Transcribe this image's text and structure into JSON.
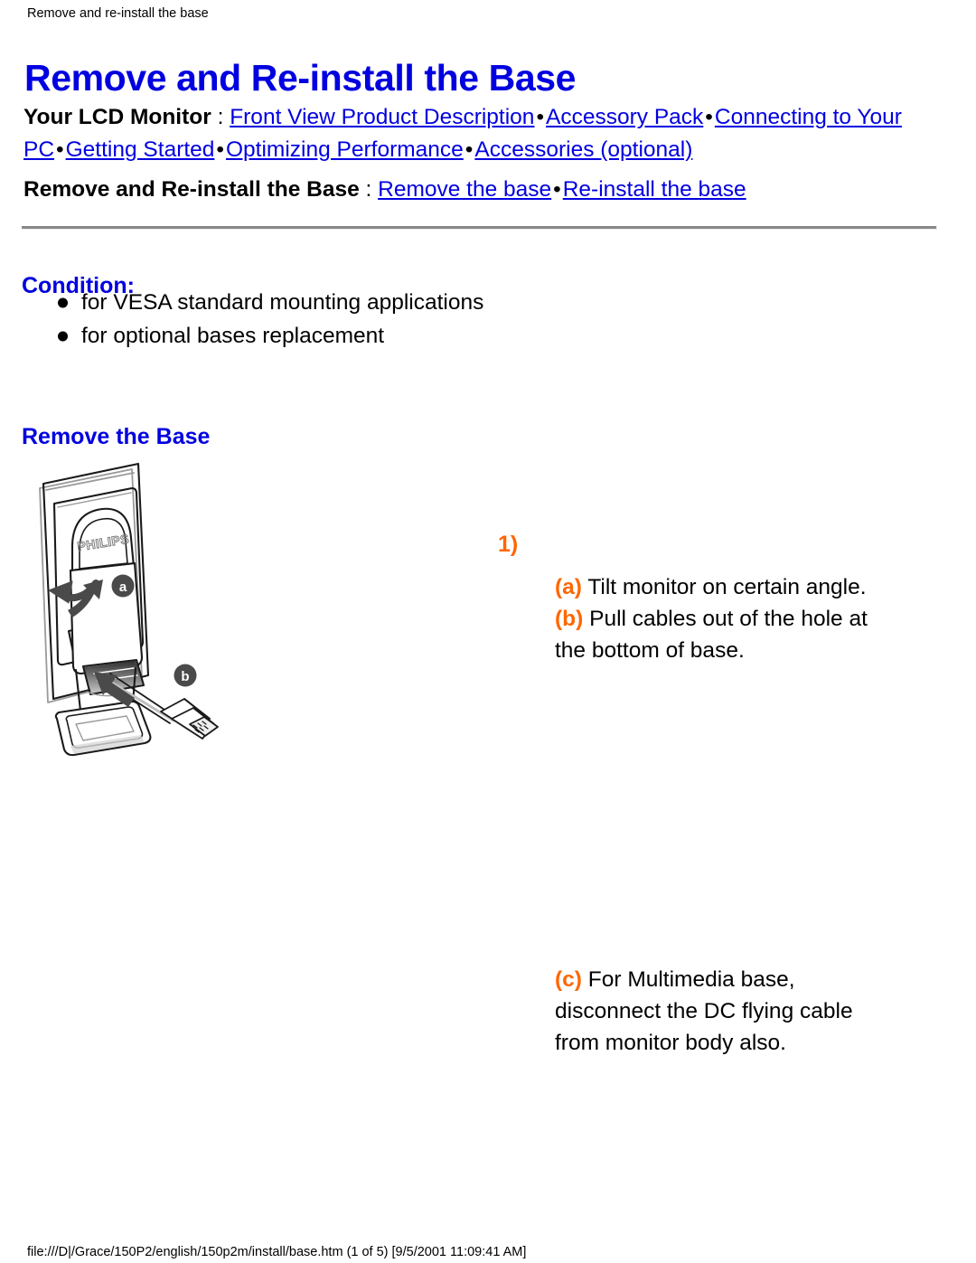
{
  "document": {
    "breadcrumb": "Remove and re-install the base",
    "title": "Remove and Re-install the Base",
    "footer": "file:///D|/Grace/150P2/english/150p2m/install/base.htm (1 of 5) [9/5/2001 11:09:41 AM]"
  },
  "colors": {
    "link": "#0000e0",
    "heading": "#0000e0",
    "accent_orange": "#ff6600",
    "text": "#000000",
    "rule": "#888888",
    "background": "#ffffff"
  },
  "nav_primary": {
    "lead": "Your LCD Monitor",
    "colon": " : ",
    "separator": "•",
    "links": [
      "Front View Product Description",
      "Accessory Pack",
      "Connecting to Your PC",
      "Getting Started",
      "Optimizing Performance",
      "Accessories (optional)"
    ]
  },
  "nav_secondary": {
    "lead": "Remove and Re-install the Base",
    "colon": " : ",
    "separator": "•",
    "links": [
      "Remove the base",
      "Re-install the base"
    ]
  },
  "condition": {
    "heading": "Condition:",
    "items": [
      "for VESA standard mounting applications",
      "for optional bases replacement"
    ]
  },
  "remove_section": {
    "heading": "Remove the Base",
    "step_number": "1)",
    "steps": [
      {
        "label": "(a)",
        "text": " Tilt monitor on certain angle."
      },
      {
        "label": "(b)",
        "text": " Pull cables out of the hole at the bottom of base."
      },
      {
        "label": "(c)",
        "text": " For Multimedia base, disconnect the DC flying cable from monitor body also."
      }
    ],
    "figure": {
      "name": "lcd-monitor-rear-with-base-illustration",
      "callout_a": "a",
      "callout_b": "b",
      "brand_text": "PHILIPS"
    }
  }
}
